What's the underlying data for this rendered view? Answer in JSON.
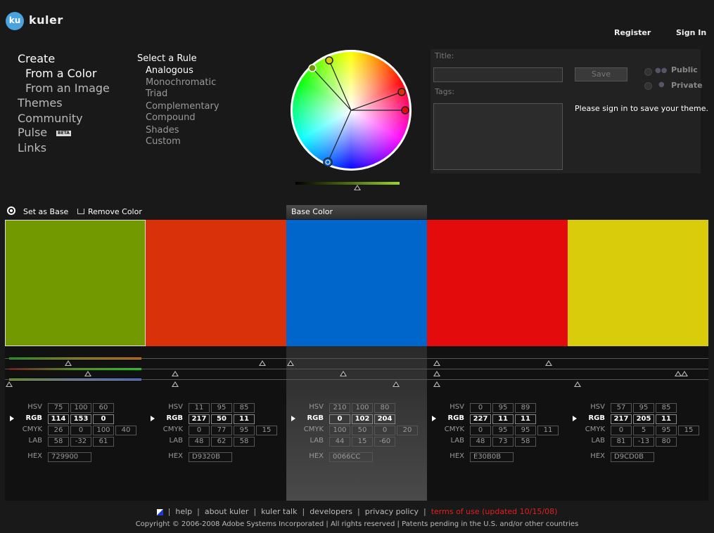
{
  "header": {
    "logo_badge": "ku",
    "logo_text": "kuler",
    "register": "Register",
    "sign_in": "Sign In"
  },
  "nav": {
    "create": "Create",
    "from_color": "From a Color",
    "from_image": "From an Image",
    "themes": "Themes",
    "community": "Community",
    "pulse": "Pulse",
    "beta": "BETA",
    "links": "Links"
  },
  "rules": {
    "title": "Select a Rule",
    "items": [
      "Analogous",
      "Monochromatic",
      "Triad",
      "Complementary",
      "Compound",
      "Shades",
      "Custom"
    ],
    "active": "Analogous"
  },
  "save_panel": {
    "title_label": "Title:",
    "tags_label": "Tags:",
    "save": "Save",
    "public": "Public",
    "private": "Private",
    "message": "Please sign in to save your theme."
  },
  "toolbar": {
    "set_as_base": "Set as Base",
    "remove_color": "Remove Color",
    "base_color_tab": "Base Color"
  },
  "labels": {
    "hsv": "HSV",
    "rgb": "RGB",
    "cmyk": "CMYK",
    "lab": "LAB",
    "hex": "HEX"
  },
  "swatches": [
    {
      "color": "#729900",
      "selected": true,
      "base": false,
      "hsv": [
        "75",
        "100",
        "60"
      ],
      "rgb": [
        "114",
        "153",
        "0"
      ],
      "cmyk": [
        "26",
        "0",
        "100",
        "40"
      ],
      "lab": [
        "58",
        "-32",
        "61"
      ],
      "hex": "729900"
    },
    {
      "color": "#D9320B",
      "selected": false,
      "base": false,
      "hsv": [
        "11",
        "95",
        "85"
      ],
      "rgb": [
        "217",
        "50",
        "11"
      ],
      "cmyk": [
        "0",
        "77",
        "95",
        "15"
      ],
      "lab": [
        "48",
        "62",
        "58"
      ],
      "hex": "D9320B"
    },
    {
      "color": "#0066CC",
      "selected": false,
      "base": true,
      "hsv": [
        "210",
        "100",
        "80"
      ],
      "rgb": [
        "0",
        "102",
        "204"
      ],
      "cmyk": [
        "100",
        "50",
        "0",
        "20"
      ],
      "lab": [
        "44",
        "15",
        "-60"
      ],
      "hex": "0066CC"
    },
    {
      "color": "#E30B0B",
      "selected": false,
      "base": false,
      "hsv": [
        "0",
        "95",
        "89"
      ],
      "rgb": [
        "227",
        "11",
        "11"
      ],
      "cmyk": [
        "0",
        "95",
        "95",
        "11"
      ],
      "lab": [
        "48",
        "73",
        "58"
      ],
      "hex": "E30B0B"
    },
    {
      "color": "#D9CD0B",
      "selected": false,
      "base": false,
      "hsv": [
        "57",
        "95",
        "85"
      ],
      "rgb": [
        "217",
        "205",
        "11"
      ],
      "cmyk": [
        "0",
        "5",
        "95",
        "15"
      ],
      "lab": [
        "81",
        "-13",
        "80"
      ],
      "hex": "D9CD0B"
    }
  ],
  "footer": {
    "help": "help",
    "about": "about kuler",
    "talk": "kuler talk",
    "developers": "developers",
    "privacy": "privacy policy",
    "terms": "terms of use (updated 10/15/08)",
    "copyright": "Copyright © 2006-2008 Adobe Systems Incorporated | All rights reserved | Patents pending in the U.S. and/or other countries"
  }
}
